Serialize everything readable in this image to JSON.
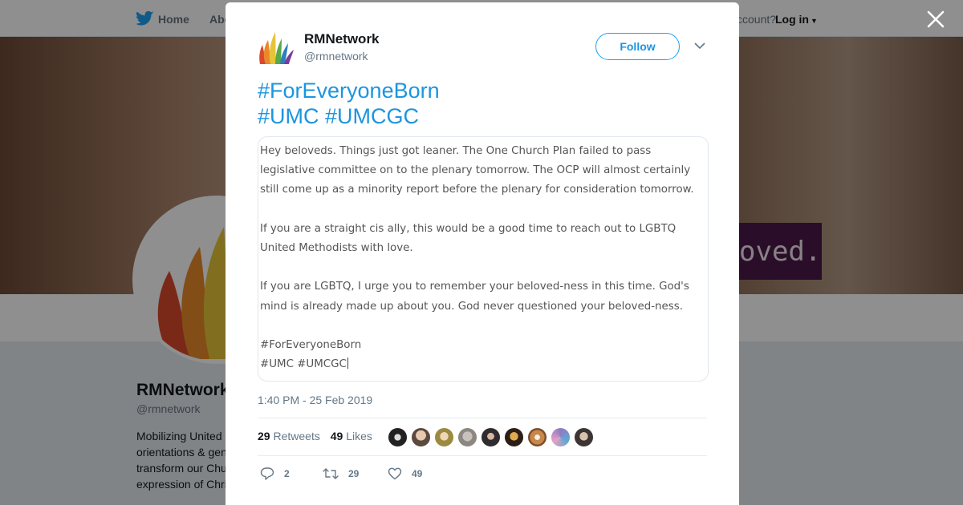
{
  "nav": {
    "home_label": "Home",
    "about_label": "Abo",
    "account_text": "ccount?",
    "login_label": "Log in"
  },
  "banner": {
    "overlay_text": "oved."
  },
  "profile": {
    "name": "RMNetwork",
    "handle": "@rmnetwork",
    "bio_lines": [
      "Mobilizing United",
      "orientations & gen",
      "transform our Chu",
      "expression of Chri"
    ]
  },
  "tweet": {
    "name": "RMNetwork",
    "handle": "@rmnetwork",
    "follow_label": "Follow",
    "text_lines": [
      "#ForEveryoneBorn",
      "#UMC #UMCGC"
    ],
    "image_text": {
      "para1": "Hey beloveds. Things just got leaner. The One Church Plan failed to pass legislative committee on to the plenary tomorrow. The OCP will almost certainly still come up as a minority report before the plenary for consideration tomorrow.",
      "para2": "If you are a straight cis ally, this would be a good time to reach out to LGBTQ United Methodists with love.",
      "para3": "If you are LGBTQ, I urge you to remember your beloved-ness in this time. God's mind is already made up about you. God never questioned your beloved-ness.",
      "tag1": "#ForEveryoneBorn",
      "tag2": "#UMC #UMCGC"
    },
    "timestamp": "1:40 PM - 25 Feb 2019",
    "retweets_count": "29",
    "retweets_label": "Retweets",
    "likes_count": "49",
    "likes_label": "Likes",
    "reply_count": "2",
    "retweet_action_count": "29",
    "like_action_count": "49"
  },
  "colors": {
    "accent": "#1da1f2",
    "link": "#1b95e0",
    "muted": "#657786"
  }
}
